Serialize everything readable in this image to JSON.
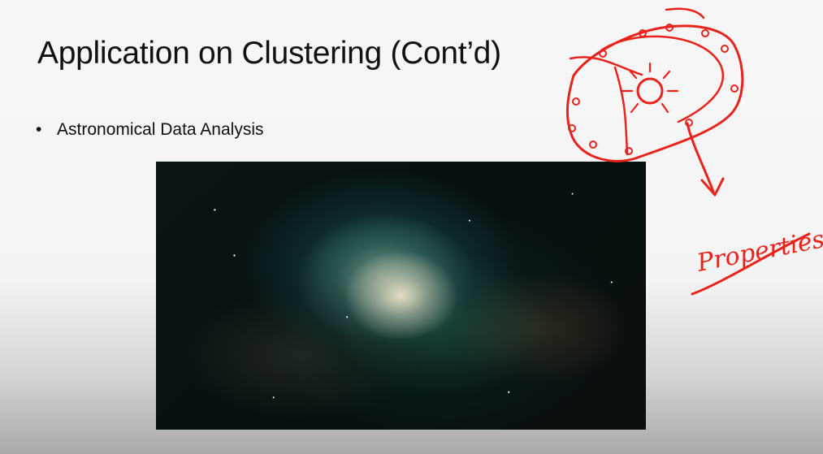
{
  "slide": {
    "title": "Application on Clustering (Cont’d)",
    "bullets": [
      {
        "marker": "•",
        "text": "Astronomical Data Analysis"
      }
    ]
  },
  "image": {
    "subject": "nebula-star-field"
  },
  "annotation": {
    "handwriting": "Properties",
    "ink_color": "#e8231b"
  }
}
